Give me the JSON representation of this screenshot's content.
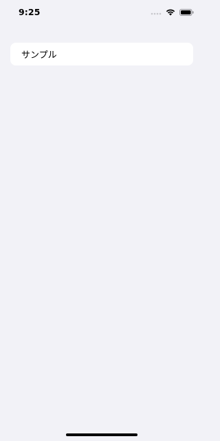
{
  "status_bar": {
    "time": "9:25",
    "icons": [
      "cellular-icon",
      "wifi-icon",
      "battery-icon"
    ]
  },
  "list": {
    "items": [
      {
        "label": "サンプル"
      }
    ]
  },
  "colors": {
    "background": "#f2f2f7",
    "card": "#ffffff",
    "text": "#000000"
  }
}
